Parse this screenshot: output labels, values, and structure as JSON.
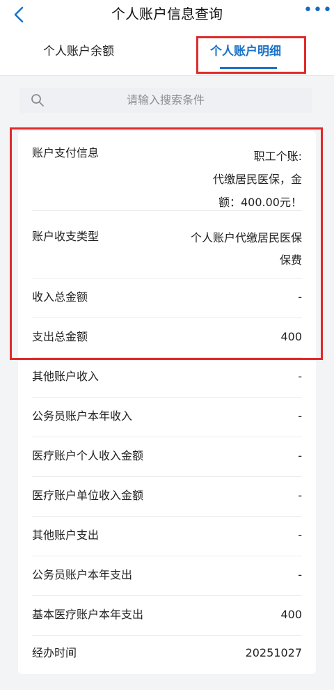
{
  "header": {
    "title": "个人账户信息查询",
    "back_icon": "chevron-left-icon",
    "more_icon": "more-dots-icon",
    "more_label": "•••",
    "accent_color": "#1a73c8"
  },
  "tabs": [
    {
      "label": "个人账户余额",
      "active": false
    },
    {
      "label": "个人账户明细",
      "active": true
    }
  ],
  "search": {
    "placeholder": "请输入搜索条件",
    "icon": "search-icon"
  },
  "details": {
    "payment_info": {
      "label": "账户支付信息",
      "line1": "职工个账:",
      "line2": "代缴居民医保，金",
      "line3": "额：400.00元！"
    },
    "type": {
      "label": "账户收支类型",
      "line1": "个人账户代缴居民医保",
      "line2": "保费"
    },
    "rows": [
      {
        "label": "收入总金额",
        "value": "-"
      },
      {
        "label": "支出总金额",
        "value": "400"
      },
      {
        "label": "其他账户收入",
        "value": "-"
      },
      {
        "label": "公务员账户本年收入",
        "value": "-"
      },
      {
        "label": "医疗账户个人收入金额",
        "value": "-"
      },
      {
        "label": "医疗账户单位收入金额",
        "value": "-"
      },
      {
        "label": "其他账户支出",
        "value": "-"
      },
      {
        "label": "公务员账户本年支出",
        "value": "-"
      },
      {
        "label": "基本医疗账户本年支出",
        "value": "400"
      },
      {
        "label": "经办时间",
        "value": "20251027"
      }
    ]
  },
  "highlight_color": "#e02a2a"
}
